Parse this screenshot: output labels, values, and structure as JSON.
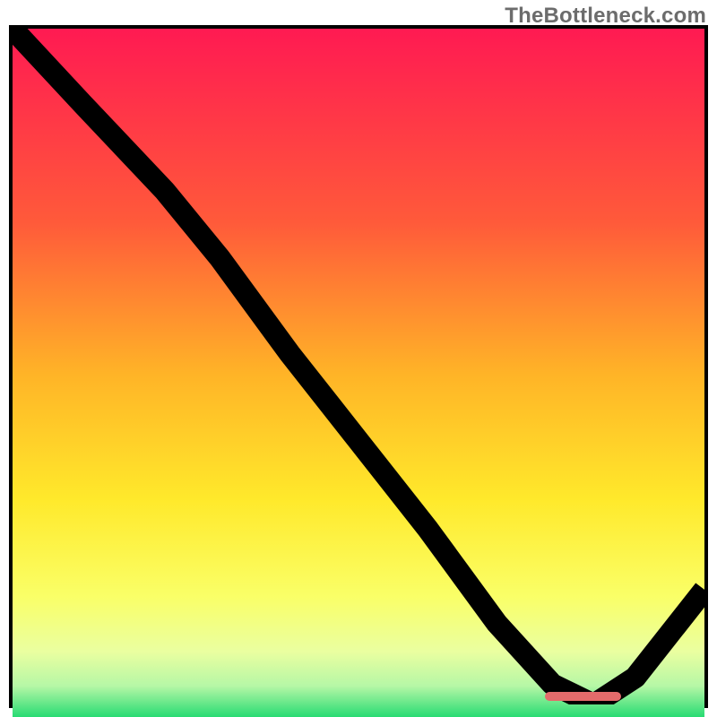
{
  "watermark": "TheBottleneck.com",
  "colors": {
    "top": "#ff1a52",
    "mid1": "#ff7a2e",
    "mid2": "#ffe92b",
    "warm": "#f7ff86",
    "base": "#17d86d",
    "marker": "#e36b6b"
  },
  "chart_data": {
    "type": "line",
    "title": "",
    "xlabel": "",
    "ylabel": "",
    "xlim": [
      0,
      100
    ],
    "ylim": [
      0,
      100
    ],
    "x": [
      0,
      10,
      22,
      30,
      40,
      50,
      60,
      70,
      78,
      84,
      90,
      100
    ],
    "values": [
      100,
      89,
      76,
      66,
      52,
      39,
      26,
      12,
      3,
      0,
      4,
      17
    ],
    "marker_range_x": [
      77,
      88
    ],
    "gradient_stops": [
      {
        "pos": 0.0,
        "color": "#ff1a52"
      },
      {
        "pos": 0.28,
        "color": "#ff5a3a"
      },
      {
        "pos": 0.5,
        "color": "#ffb427"
      },
      {
        "pos": 0.68,
        "color": "#ffe92b"
      },
      {
        "pos": 0.82,
        "color": "#faff67"
      },
      {
        "pos": 0.9,
        "color": "#eaffa0"
      },
      {
        "pos": 0.95,
        "color": "#b6f7a6"
      },
      {
        "pos": 1.0,
        "color": "#17d86d"
      }
    ]
  }
}
